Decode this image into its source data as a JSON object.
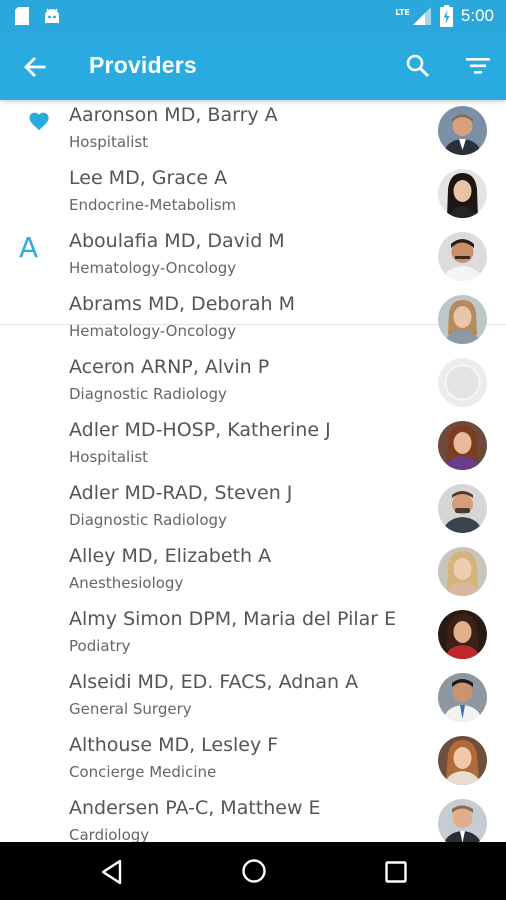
{
  "status_bar": {
    "network_label": "LTE",
    "time": "5:00"
  },
  "app_bar": {
    "title": "Providers"
  },
  "favorites": {
    "icon": "heart-icon"
  },
  "section_letter": "A",
  "providers": [
    {
      "name": "Aaronson MD, Barry A",
      "specialty": "Hospitalist"
    },
    {
      "name": "Lee MD, Grace A",
      "specialty": "Endocrine-Metabolism"
    },
    {
      "name": "Aboulafia MD, David M",
      "specialty": "Hematology-Oncology"
    },
    {
      "name": "Abrams MD, Deborah M",
      "specialty": "Hematology-Oncology"
    },
    {
      "name": "Aceron ARNP, Alvin P",
      "specialty": "Diagnostic Radiology"
    },
    {
      "name": "Adler MD-HOSP, Katherine J",
      "specialty": "Hospitalist"
    },
    {
      "name": "Adler MD-RAD, Steven J",
      "specialty": "Diagnostic Radiology"
    },
    {
      "name": "Alley MD, Elizabeth A",
      "specialty": "Anesthesiology"
    },
    {
      "name": "Almy Simon DPM, Maria del Pilar E",
      "specialty": "Podiatry"
    },
    {
      "name": "Alseidi MD, ED. FACS, Adnan A",
      "specialty": "General Surgery"
    },
    {
      "name": "Althouse MD, Lesley F",
      "specialty": "Concierge Medicine"
    },
    {
      "name": "Andersen PA-C, Matthew E",
      "specialty": "Cardiology"
    }
  ],
  "colors": {
    "accent": "#2aabe0",
    "status_bar": "#2aa8db",
    "nav_bar": "#000000"
  }
}
